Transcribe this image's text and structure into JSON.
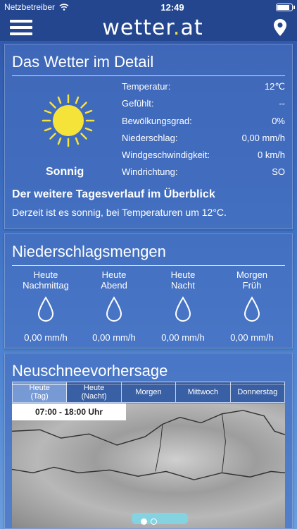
{
  "status": {
    "carrier": "Netzbetreiber",
    "time": "12:49"
  },
  "nav": {
    "logo_main": "wetter",
    "logo_dot": ".",
    "logo_tld": "at"
  },
  "detail": {
    "title": "Das Wetter im Detail",
    "condition": "Sonnig",
    "rows": [
      {
        "label": "Temperatur:",
        "value": "12℃"
      },
      {
        "label": "Gefühlt:",
        "value": "--"
      },
      {
        "label": "Bewölkungsgrad:",
        "value": "0%"
      },
      {
        "label": "Niederschlag:",
        "value": "0,00 mm/h"
      },
      {
        "label": "Windgeschwindigkeit:",
        "value": "0 km/h"
      },
      {
        "label": "Windrichtung:",
        "value": "SO"
      }
    ],
    "subheading": "Der weitere Tagesverlauf im Überblick",
    "summary": "Derzeit ist es sonnig, bei Temperaturen um 12°C."
  },
  "precip": {
    "title": "Niederschlagsmengen",
    "cols": [
      {
        "line1": "Heute",
        "line2": "Nachmittag",
        "amount": "0,00 mm/h"
      },
      {
        "line1": "Heute",
        "line2": "Abend",
        "amount": "0,00 mm/h"
      },
      {
        "line1": "Heute",
        "line2": "Nacht",
        "amount": "0,00 mm/h"
      },
      {
        "line1": "Morgen",
        "line2": "Früh",
        "amount": "0,00 mm/h"
      }
    ]
  },
  "snow": {
    "title": "Neuschneevorhersage",
    "tabs": [
      {
        "line1": "Heute",
        "line2": "(Tag)"
      },
      {
        "line1": "Heute",
        "line2": "(Nacht)"
      },
      {
        "line1": "Morgen",
        "line2": ""
      },
      {
        "line1": "Mittwoch",
        "line2": ""
      },
      {
        "line1": "Donnerstag",
        "line2": ""
      }
    ],
    "time_range": "07:00 - 18:00 Uhr"
  }
}
